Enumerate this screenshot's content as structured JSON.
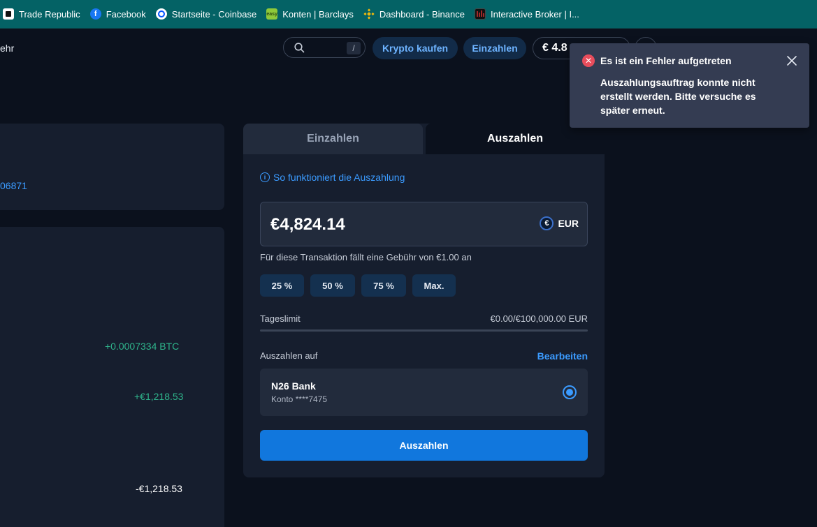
{
  "bookmarks": [
    {
      "label": "Trade Republic",
      "icon": "trade-republic-icon"
    },
    {
      "label": "Facebook",
      "icon": "facebook-icon"
    },
    {
      "label": "Startseite - Coinbase",
      "icon": "coinbase-icon"
    },
    {
      "label": "Konten | Barclays",
      "icon": "barclays-icon"
    },
    {
      "label": "Dashboard - Binance",
      "icon": "binance-icon"
    },
    {
      "label": "Interactive Broker | I...",
      "icon": "interactive-brokers-icon"
    }
  ],
  "header": {
    "partial_text": "ehr",
    "search_shortcut": "/",
    "buy_crypto_label": "Krypto kaufen",
    "deposit_label": "Einzahlen",
    "balance_partial": "€ 4.8"
  },
  "left": {
    "link_partial": "06871",
    "values": [
      "+0.0007334 BTC",
      "+€1,218.53",
      "-€1,218.53"
    ]
  },
  "card": {
    "tab_deposit": "Einzahlen",
    "tab_withdraw": "Auszahlen",
    "info_link": "So funktioniert die Auszahlung",
    "amount": "€4,824.14",
    "currency": "EUR",
    "fee_note": "Für diese Transaktion fällt eine Gebühr von €1.00 an",
    "percent_buttons": [
      "25 %",
      "50 %",
      "75 %",
      "Max."
    ],
    "daily_limit_label": "Tageslimit",
    "daily_limit_value": "€0.00/€100,000.00 EUR",
    "daily_limit_used_fraction": 0.0,
    "withdraw_to_label": "Auszahlen auf",
    "edit_label": "Bearbeiten",
    "bank_name": "N26 Bank",
    "bank_account": "Konto ****7475",
    "submit_label": "Auszahlen"
  },
  "toast": {
    "title": "Es ist ein Fehler aufgetreten",
    "message": "Auszahlungsauftrag konnte nicht erstellt werden. Bitte versuche es später erneut."
  },
  "colors": {
    "accent": "#3b9bff",
    "positive": "#2fb58c",
    "error": "#e84d5c",
    "bookmarks_bar": "#046265"
  }
}
